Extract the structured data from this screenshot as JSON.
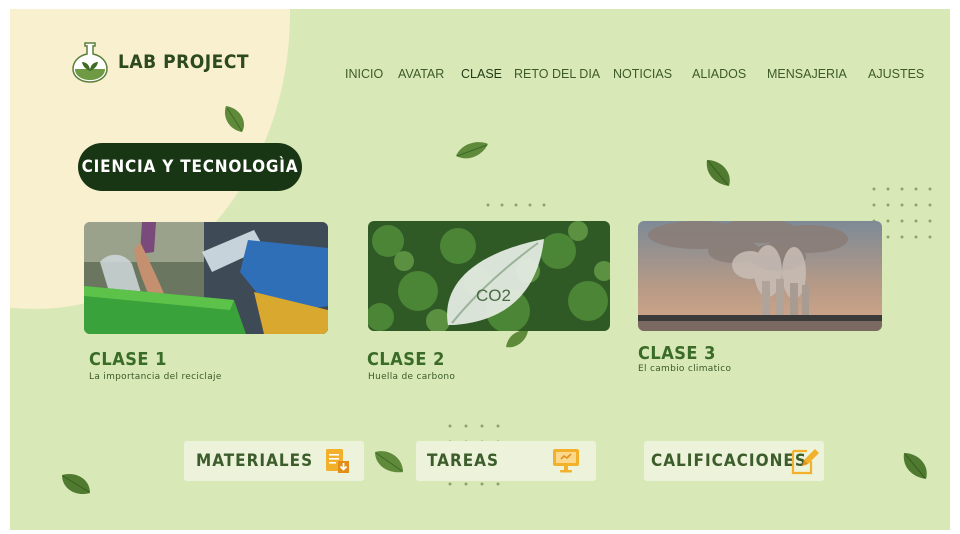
{
  "app": {
    "brand": "LAB PROJECT"
  },
  "nav": [
    {
      "label": "INICIO"
    },
    {
      "label": "AVATAR"
    },
    {
      "label": "CLASE",
      "active": true
    },
    {
      "label": "RETO DEL DIA"
    },
    {
      "label": "NOTICIAS"
    },
    {
      "label": "ALIADOS"
    },
    {
      "label": "MENSAJERIA"
    },
    {
      "label": "AJUSTES"
    }
  ],
  "section": {
    "title": "CIENCIA Y TECNOLOGÌA"
  },
  "classes": [
    {
      "title": "CLASE 1",
      "subtitle": "La importancia del reciclaje",
      "image": "recycling-photo"
    },
    {
      "title": "CLASE 2",
      "subtitle": "Huella de carbono",
      "image": "co2-leaf-forest-photo",
      "image_text": "CO2"
    },
    {
      "title": "CLASE 3",
      "subtitle": "El cambio climatico",
      "image": "smokestacks-photo"
    }
  ],
  "actions": [
    {
      "label": "MATERIALES",
      "icon": "document-download-icon"
    },
    {
      "label": "TAREAS",
      "icon": "computer-monitor-icon"
    },
    {
      "label": "CALIFICACIONES",
      "icon": "edit-document-icon"
    }
  ],
  "colors": {
    "background": "#d8e8b6",
    "blob": "#f8f0cf",
    "dark_green": "#193614",
    "text_green": "#3a6b29",
    "icon_orange": "#f3b02b",
    "leaf": "#5e8a3a"
  }
}
